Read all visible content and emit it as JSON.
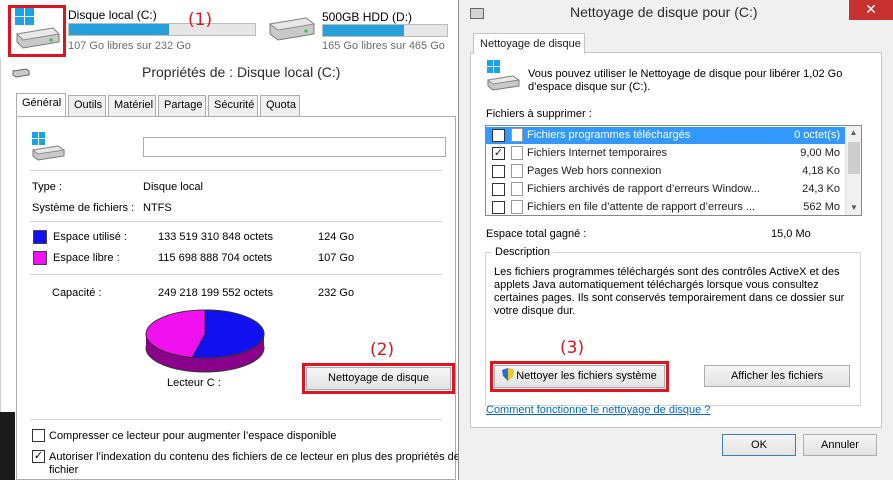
{
  "explorer": {
    "drive_c": {
      "name": "Disque local (C:)",
      "free_text": "107 Go libres sur 232 Go",
      "used_fraction": 0.54
    },
    "drive_d": {
      "name": "500GB HDD (D:)",
      "free_text": "165 Go libres sur 465 Go",
      "used_fraction": 0.65
    }
  },
  "annotations": {
    "step1": "(1)",
    "step2": "(2)",
    "step3": "(3)"
  },
  "properties": {
    "title": "Propriétés de : Disque local (C:)",
    "tabs": [
      "Général",
      "Outils",
      "Matériel",
      "Partage",
      "Sécurité",
      "Quota"
    ],
    "active_tab": "Général",
    "volume_name": "",
    "type_label": "Type :",
    "type_value": "Disque local",
    "fs_label": "Système de fichiers :",
    "fs_value": "NTFS",
    "used_label": "Espace utilisé :",
    "used_bytes": "133 519 310 848 octets",
    "used_size": "124 Go",
    "free_label": "Espace libre :",
    "free_bytes": "115 698 888 704 octets",
    "free_size": "107 Go",
    "capacity_label": "Capacité :",
    "capacity_bytes": "249 218 199 552 octets",
    "capacity_size": "232 Go",
    "drive_label": "Lecteur C :",
    "cleanup_button": "Nettoyage de disque",
    "compress_label": "Compresser ce lecteur pour augmenter l’espace disponible",
    "compress_checked": false,
    "index_label_line1": "Autoriser l’indexation du contenu des fichiers de ce lecteur en plus des propriétés de",
    "index_label_line2": "fichier",
    "index_checked": true,
    "colors": {
      "used": "#1010f0",
      "free": "#f010f0"
    }
  },
  "cleanup": {
    "title": "Nettoyage de disque pour  (C:)",
    "tab": "Nettoyage de disque",
    "intro_line1": "Vous pouvez utiliser le Nettoyage de disque pour libérer 1,02 Go",
    "intro_line2": "d’espace disque sur  (C:).",
    "files_label": "Fichiers à supprimer :",
    "files": [
      {
        "name": "Fichiers programmes téléchargés",
        "size": "0 octet(s)",
        "checked": true,
        "selected": true
      },
      {
        "name": "Fichiers Internet temporaires",
        "size": "9,00 Mo",
        "checked": true,
        "selected": false
      },
      {
        "name": "Pages Web hors connexion",
        "size": "4,18 Ko",
        "checked": false,
        "selected": false
      },
      {
        "name": "Fichiers archivés de rapport d’erreurs Window...",
        "size": "24,3 Ko",
        "checked": false,
        "selected": false
      },
      {
        "name": "Fichiers en file d’attente de rapport d’erreurs ...",
        "size": "562 Mo",
        "checked": false,
        "selected": false
      }
    ],
    "total_label": "Espace total gagné :",
    "total_value": "15,0 Mo",
    "description_label": "Description",
    "description_lines": [
      "Les fichiers programmes téléchargés sont des contrôles ActiveX et des",
      "applets Java automatiquement téléchargés lorsque vous consultez",
      "certaines pages. Ils sont conservés temporairement dans ce dossier sur",
      "votre disque dur."
    ],
    "system_button": "Nettoyer les fichiers système",
    "show_button": "Afficher les fichiers",
    "help_link": "Comment fonctionne le nettoyage de disque ?",
    "ok_button": "OK",
    "cancel_button": "Annuler",
    "close_icon": "close-icon"
  }
}
